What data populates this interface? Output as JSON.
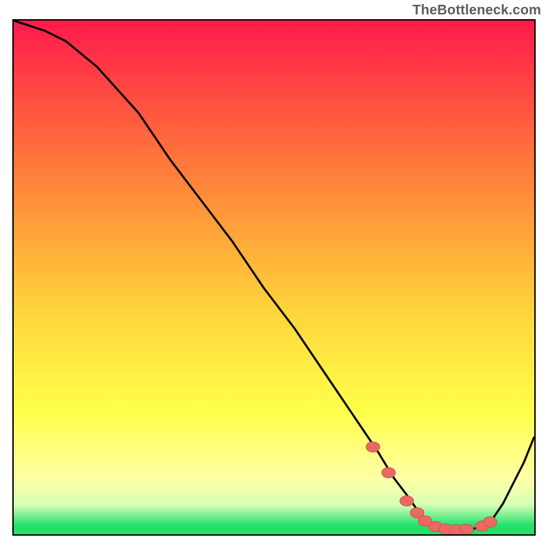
{
  "watermark": "TheBottleneck.com",
  "colors": {
    "top": "#ff1a4b",
    "mid_upper": "#ff7a3a",
    "mid": "#ffd23a",
    "mid_lower": "#ffff4a",
    "pale_yellow": "#ffffa6",
    "pale_green": "#d6ffb5",
    "green": "#22e06b",
    "border": "#000000",
    "curve": "#000000",
    "marker_fill": "#ea6a63",
    "marker_stroke": "#d1544f"
  },
  "chart_data": {
    "type": "line",
    "title": "",
    "xlabel": "",
    "ylabel": "",
    "xlim": [
      0,
      100
    ],
    "ylim": [
      0,
      100
    ],
    "series": [
      {
        "name": "bottleneck-curve",
        "x": [
          0,
          6,
          10,
          16,
          24,
          30,
          36,
          42,
          48,
          54,
          58,
          62,
          66,
          70,
          73,
          76,
          78,
          80,
          82,
          84,
          86,
          88,
          90,
          92,
          94,
          96,
          98,
          100
        ],
        "y": [
          100,
          98,
          96,
          91,
          82,
          73,
          65,
          57,
          48,
          40,
          34,
          28,
          22,
          16,
          11,
          7,
          4,
          2,
          1.2,
          0.8,
          0.8,
          1,
          1.5,
          3,
          6,
          10,
          14,
          19
        ]
      }
    ],
    "markers": {
      "name": "highlight-points",
      "x": [
        69,
        72,
        75.5,
        77.5,
        79,
        81,
        83,
        85,
        87,
        90,
        91.5
      ],
      "y": [
        17,
        12,
        6.5,
        4.2,
        2.6,
        1.5,
        1.0,
        0.9,
        1.0,
        1.6,
        2.4
      ]
    }
  }
}
